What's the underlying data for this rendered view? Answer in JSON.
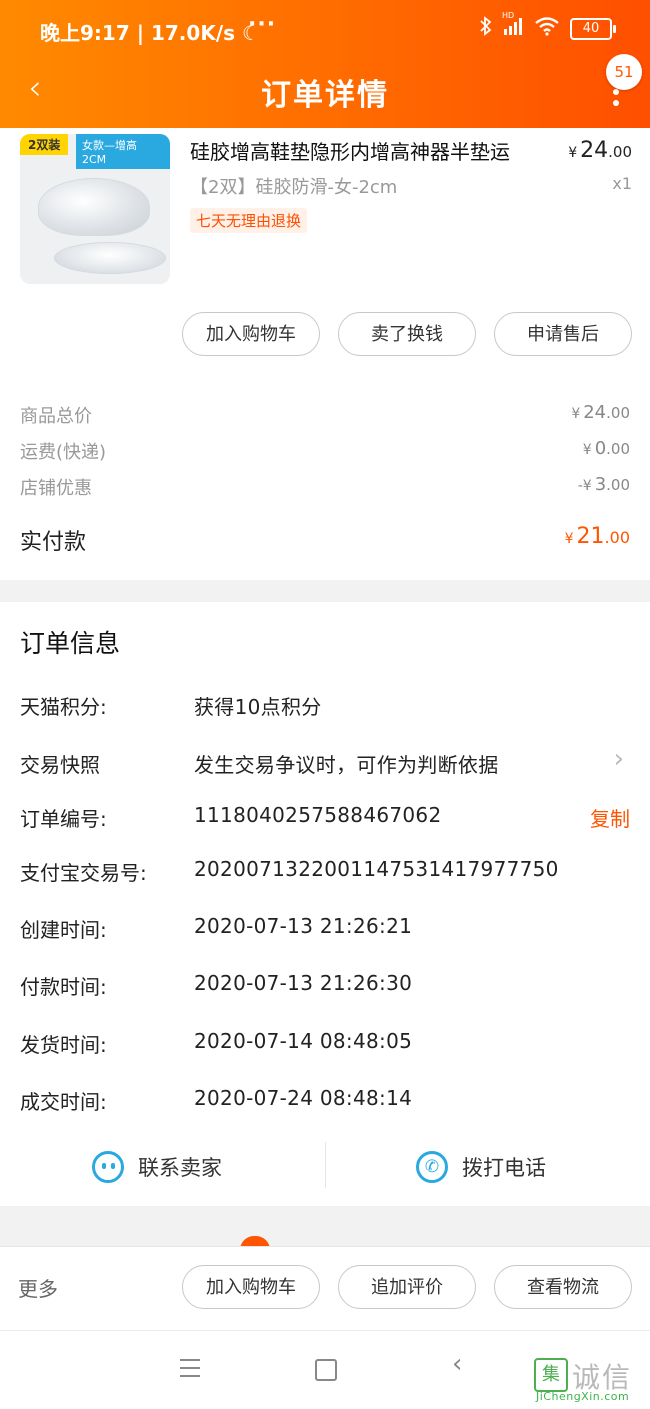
{
  "status_bar": {
    "time_speed": "晚上9:17 | 17.0K/s",
    "moon": "☾",
    "dots": "···",
    "icons": [
      "bluetooth-icon",
      "signal-icon",
      "wifi-icon"
    ],
    "hd": "HD",
    "battery": "40"
  },
  "header": {
    "title": "订单详情",
    "back": "‹",
    "message_count": "51"
  },
  "product": {
    "thumb_tag_left": "2双装",
    "thumb_tag_right": "女款—增高 2CM",
    "title": "硅胶增高鞋垫隐形内增高神器半垫运",
    "price_int": "24",
    "price_dec": ".00",
    "currency": "¥",
    "spec": "【2双】硅胶防滑-女-2cm",
    "qty": "x1",
    "promise_tag": "七天无理由退换"
  },
  "item_actions": [
    "加入购物车",
    "卖了换钱",
    "申请售后"
  ],
  "summary": {
    "rows": [
      {
        "label": "商品总价",
        "value_int": "24",
        "value_dec": ".00",
        "prefix": "¥"
      },
      {
        "label": "运费(快递)",
        "value_int": "0",
        "value_dec": ".00",
        "prefix": "¥"
      },
      {
        "label": "店铺优惠",
        "value_int": "3",
        "value_dec": ".00",
        "prefix": "-¥"
      }
    ],
    "total_label": "实付款",
    "total_int": "21",
    "total_dec": ".00",
    "total_prefix": "¥"
  },
  "order_info": {
    "title": "订单信息",
    "rows": [
      {
        "label": "天猫积分:",
        "value": "获得10点积分"
      },
      {
        "label": "交易快照",
        "value": "发生交易争议时，可作为判断依据"
      },
      {
        "label": "订单编号:",
        "value": "1118040257588467062"
      },
      {
        "label": "支付宝交易号:",
        "value": "2020071322001147531417977750"
      },
      {
        "label": "创建时间:",
        "value": "2020-07-13 21:26:21"
      },
      {
        "label": "付款时间:",
        "value": "2020-07-13 21:26:30"
      },
      {
        "label": "发货时间:",
        "value": "2020-07-14 08:48:05"
      },
      {
        "label": "成交时间:",
        "value": "2020-07-24 08:48:14"
      }
    ],
    "copy_label": "复制",
    "snapshot_chevron": "›"
  },
  "contact": {
    "seller_label": "联系卖家",
    "phone_label": "拨打电话",
    "phone_glyph": "✆"
  },
  "bottom_bar": {
    "more_label": "更多",
    "buttons": [
      "加入购物车",
      "追加评价",
      "查看物流"
    ]
  },
  "system_nav": {
    "back_glyph": "‹"
  },
  "watermark": {
    "logo": "集",
    "text": "诚信",
    "url": "JiChengXin.com"
  },
  "colors": {
    "accent": "#ff5500",
    "header_start": "#ff8a00",
    "header_end": "#ff4f00",
    "link_blue": "#2aa9e0"
  }
}
